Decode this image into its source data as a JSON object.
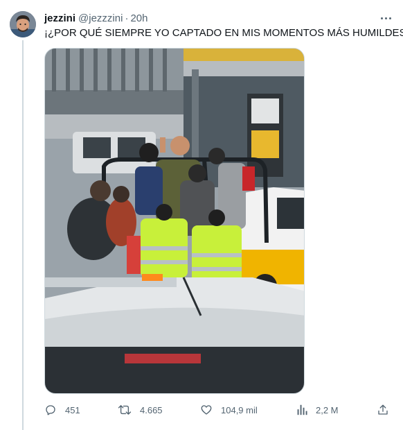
{
  "author": {
    "display_name": "jezzini",
    "handle": "@jezzzini",
    "separator": "·",
    "time": "20h"
  },
  "tweet": {
    "text": "¡¿POR QUÉ SIEMPRE YO CAPTADO EN MIS MOMENTOS MÁS HUMILDES?!"
  },
  "media": {
    "description_icons": [
      "pickup-truck",
      "police-car",
      "taxi"
    ]
  },
  "actions": {
    "replies": "451",
    "reposts": "4.665",
    "likes": "104,9 mil",
    "views": "2,2 M"
  },
  "icons": [
    "more-icon",
    "reply-icon",
    "repost-icon",
    "like-icon",
    "views-icon",
    "share-icon"
  ],
  "colors": {
    "text": "#0f1419",
    "secondary": "#536471",
    "thread_line": "#cfd9de",
    "safety_vest": "#c8f03a",
    "taxi_yellow": "#f0b400"
  }
}
